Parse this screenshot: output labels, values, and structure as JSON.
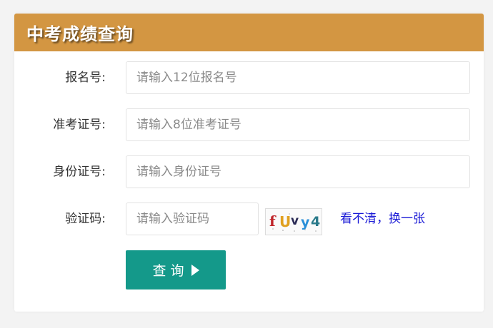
{
  "header": {
    "title": "中考成绩查询",
    "color": "#d39642"
  },
  "form": {
    "registration": {
      "label": "报名号:",
      "placeholder": "请输入12位报名号",
      "value": ""
    },
    "admission": {
      "label": "准考证号:",
      "placeholder": "请输入8位准考证号",
      "value": ""
    },
    "id_card": {
      "label": "身份证号:",
      "placeholder": "请输入身份证号",
      "value": ""
    },
    "captcha": {
      "label": "验证码:",
      "placeholder": "请输入验证码",
      "value": "",
      "image_text": "fUvy4",
      "refresh_link": "看不清，换一张"
    },
    "submit": {
      "label": "查询",
      "icon": "play-icon",
      "color": "#14998a"
    }
  }
}
